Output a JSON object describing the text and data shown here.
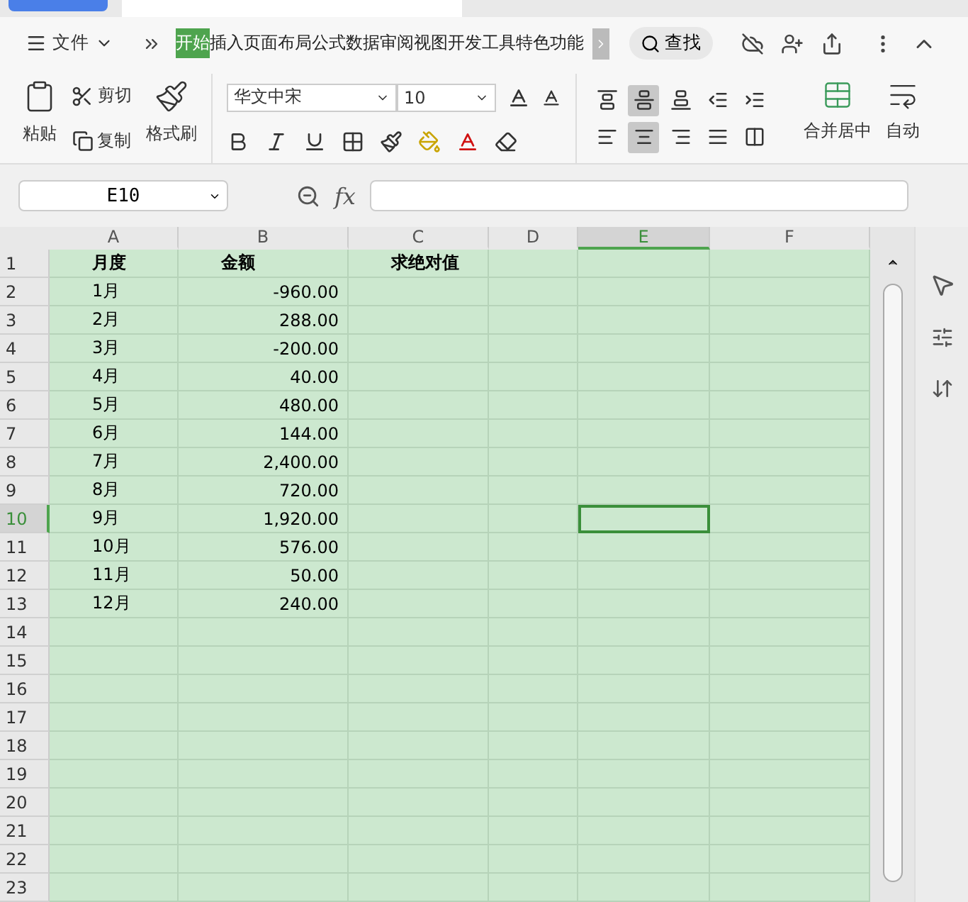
{
  "menu": {
    "file": "文件",
    "tabs": [
      {
        "label": "开始",
        "selected": true
      },
      {
        "label": "插入",
        "selected": false
      },
      {
        "label": "页面布局",
        "selected": false
      },
      {
        "label": "公式",
        "selected": false
      },
      {
        "label": "数据",
        "selected": false
      },
      {
        "label": "审阅",
        "selected": false
      },
      {
        "label": "视图",
        "selected": false
      },
      {
        "label": "开发工具",
        "selected": false
      },
      {
        "label": "特色功能",
        "selected": false
      }
    ],
    "search": "查找"
  },
  "ribbon": {
    "paste": "粘贴",
    "cut": "剪切",
    "copy": "复制",
    "format_painter": "格式刷",
    "font": "华文中宋",
    "size": "10",
    "merge": "合并居中",
    "wrap": "自动",
    "align": [
      {
        "kind": "top",
        "selected": false
      },
      {
        "kind": "middle",
        "selected": true
      },
      {
        "kind": "bottom",
        "selected": false
      },
      {
        "kind": "outdent",
        "selected": false
      },
      {
        "kind": "indent",
        "selected": false
      },
      {
        "kind": "left",
        "selected": false
      },
      {
        "kind": "center",
        "selected": true
      },
      {
        "kind": "right",
        "selected": false
      },
      {
        "kind": "justify",
        "selected": false
      },
      {
        "kind": "distribute",
        "selected": false
      }
    ]
  },
  "formula_bar": {
    "cell": "E10",
    "fx": "fx"
  },
  "sheet": {
    "columns": [
      {
        "label": "A",
        "selected": false
      },
      {
        "label": "B",
        "selected": false
      },
      {
        "label": "C",
        "selected": false
      },
      {
        "label": "D",
        "selected": false
      },
      {
        "label": "E",
        "selected": true
      },
      {
        "label": "F",
        "selected": false
      }
    ],
    "rows": [
      {
        "header": "1",
        "selected": false,
        "cells": [
          "月度",
          "金额",
          "求绝对值"
        ]
      },
      {
        "header": "2",
        "selected": false,
        "cells": [
          "1月",
          "-960.00"
        ]
      },
      {
        "header": "3",
        "selected": false,
        "cells": [
          "2月",
          "288.00"
        ]
      },
      {
        "header": "4",
        "selected": false,
        "cells": [
          "3月",
          "-200.00"
        ]
      },
      {
        "header": "5",
        "selected": false,
        "cells": [
          "4月",
          "40.00"
        ]
      },
      {
        "header": "6",
        "selected": false,
        "cells": [
          "5月",
          "480.00"
        ]
      },
      {
        "header": "7",
        "selected": false,
        "cells": [
          "6月",
          "144.00"
        ]
      },
      {
        "header": "8",
        "selected": false,
        "cells": [
          "7月",
          "2,400.00"
        ]
      },
      {
        "header": "9",
        "selected": false,
        "cells": [
          "8月",
          "720.00"
        ]
      },
      {
        "header": "10",
        "selected": true,
        "cells": [
          "9月",
          "1,920.00"
        ]
      },
      {
        "header": "11",
        "selected": false,
        "cells": [
          "10月",
          "576.00"
        ]
      },
      {
        "header": "12",
        "selected": false,
        "cells": [
          "11月",
          "50.00"
        ]
      },
      {
        "header": "13",
        "selected": false,
        "cells": [
          "12月",
          "240.00"
        ]
      },
      {
        "header": "14",
        "selected": false
      },
      {
        "header": "15",
        "selected": false
      },
      {
        "header": "16",
        "selected": false
      },
      {
        "header": "17",
        "selected": false
      },
      {
        "header": "18",
        "selected": false
      },
      {
        "header": "19",
        "selected": false
      },
      {
        "header": "20",
        "selected": false
      },
      {
        "header": "21",
        "selected": false
      },
      {
        "header": "22",
        "selected": false
      },
      {
        "header": "23",
        "selected": false
      }
    ]
  }
}
